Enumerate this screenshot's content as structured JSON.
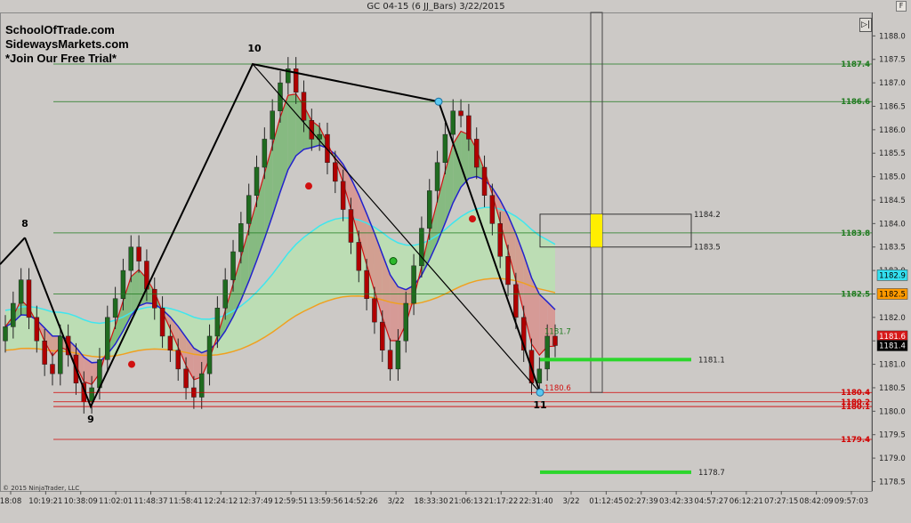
{
  "window": {
    "title": "GC 04-15 (6 JJ_Bars)  3/22/2015"
  },
  "branding": {
    "line1": "SchoolOfTrade.com",
    "line2": "SidewaysMarkets.com",
    "line3": "*Join Our Free Trial*"
  },
  "copyright": "© 2015 NinjaTrader, LLC",
  "controls": {
    "scroll_icon": "scroll-to-end-icon",
    "scroll_glyph": "▷|",
    "f_label": "F"
  },
  "colors": {
    "background": "#ccc9c6",
    "up_bar": "#1f6b1f",
    "down_bar": "#b00000",
    "accent_green": "#2cd62c",
    "zigzag": "#000000"
  },
  "chart_data": {
    "type": "candlestick",
    "instrument": "GC 04-15",
    "bar_type": "6 JJ_Bars",
    "ylim": [
      1178.3,
      1188.5
    ],
    "y_ticks": [
      "1188.0",
      "1187.5",
      "1187.0",
      "1186.5",
      "1186.0",
      "1185.5",
      "1185.0",
      "1184.5",
      "1184.0",
      "1183.5",
      "1183.0",
      "1182.5",
      "1182.0",
      "1181.5",
      "1181.0",
      "1180.5",
      "1180.0",
      "1179.5",
      "1179.0",
      "1178.5"
    ],
    "x_ticks": [
      "18:08",
      "10:19:21",
      "10:38:09",
      "11:02:01",
      "11:48:37",
      "11:58:41",
      "12:24:12",
      "12:37:49",
      "12:59:51",
      "13:59:56",
      "14:52:26",
      "3/22",
      "18:33:30",
      "21:06:13",
      "21:17:22",
      "22:31:40",
      "3/22",
      "01:12:45",
      "02:27:39",
      "03:42:33",
      "04:57:27",
      "06:12:21",
      "07:27:15",
      "08:42:09",
      "09:57:03"
    ],
    "zigzag": [
      {
        "label": "8",
        "price": 1183.7
      },
      {
        "label": "9",
        "price": 1180.1
      },
      {
        "label": "10",
        "price": 1187.4
      },
      {
        "label": "11",
        "price": 1180.4
      }
    ],
    "intermediate_high": 1186.6,
    "levels": [
      {
        "value": "1187.4",
        "color": "#1e7a1e"
      },
      {
        "value": "1186.6",
        "color": "#1e7a1e"
      },
      {
        "value": "1183.8",
        "color": "#1e7a1e"
      },
      {
        "value": "1182.5",
        "color": "#1e7a1e"
      },
      {
        "value": "1180.4",
        "color": "#d10000"
      },
      {
        "value": "1180.2",
        "color": "#d10000"
      },
      {
        "value": "1180.1",
        "color": "#d10000"
      },
      {
        "value": "1179.4",
        "color": "#d10000"
      }
    ],
    "price_tags": [
      {
        "value": "1182.9",
        "bg": "#33e0f0",
        "fg": "#000000"
      },
      {
        "value": "1182.5",
        "bg": "#ff9a00",
        "fg": "#000000"
      },
      {
        "value": "1181.6",
        "bg": "#d81818",
        "fg": "#ffffff"
      },
      {
        "value": "1181.4",
        "bg": "#000000",
        "fg": "#ffffff"
      }
    ],
    "box": {
      "high": "1184.2",
      "low": "1183.5"
    },
    "targets": [
      "1181.1",
      "1178.7"
    ],
    "last_low_label": "1180.6",
    "current_label": "1181.7",
    "close_path": [
      1181.8,
      1182.3,
      1182.8,
      1182.0,
      1181.5,
      1181.0,
      1180.8,
      1181.6,
      1181.2,
      1180.6,
      1180.2,
      1180.5,
      1181.1,
      1182.0,
      1182.4,
      1183.0,
      1183.5,
      1183.2,
      1182.6,
      1182.2,
      1181.6,
      1181.3,
      1180.9,
      1180.5,
      1180.3,
      1180.8,
      1181.6,
      1182.2,
      1182.8,
      1183.4,
      1184.0,
      1184.6,
      1185.2,
      1185.8,
      1186.4,
      1187.0,
      1187.3,
      1186.8,
      1186.2,
      1185.8,
      1185.9,
      1185.3,
      1184.9,
      1184.3,
      1183.6,
      1183.0,
      1182.4,
      1181.9,
      1181.3,
      1180.9,
      1181.5,
      1182.3,
      1183.1,
      1183.9,
      1184.7,
      1185.3,
      1185.9,
      1186.4,
      1186.3,
      1185.8,
      1185.2,
      1184.6,
      1184.0,
      1183.3,
      1182.7,
      1182.0,
      1181.3,
      1180.6,
      1180.9,
      1181.6,
      1181.4
    ]
  }
}
